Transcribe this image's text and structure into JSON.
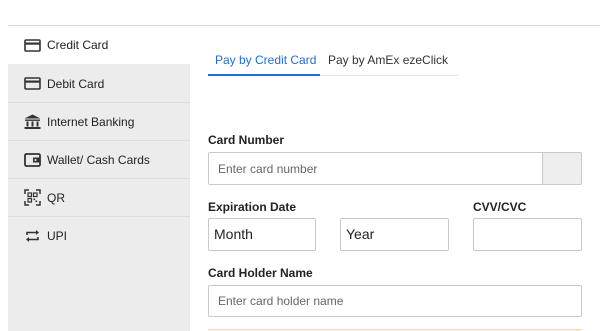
{
  "sidebar": {
    "items": [
      {
        "label": "Credit Card",
        "icon": "credit-card-icon",
        "active": true
      },
      {
        "label": "Debit Card",
        "icon": "debit-card-icon",
        "active": false
      },
      {
        "label": "Internet Banking",
        "icon": "bank-icon",
        "active": false
      },
      {
        "label": "Wallet/ Cash Cards",
        "icon": "wallet-icon",
        "active": false
      },
      {
        "label": "QR",
        "icon": "qr-code-icon",
        "active": false
      },
      {
        "label": "UPI",
        "icon": "upi-transfer-icon",
        "active": false
      }
    ]
  },
  "tabs": [
    {
      "label": "Pay by Credit Card",
      "active": true
    },
    {
      "label": "Pay by AmEx ezeClick",
      "active": false
    }
  ],
  "form": {
    "card_number_label": "Card Number",
    "card_number_placeholder": "Enter card number",
    "expiration_label": "Expiration Date",
    "month_value": "Month",
    "year_value": "Year",
    "cvv_label": "CVV/CVC",
    "holder_label": "Card Holder Name",
    "holder_placeholder": "Enter card holder name"
  },
  "colors": {
    "accent": "#1f6fd0",
    "sidebar_bg": "#ececec"
  }
}
